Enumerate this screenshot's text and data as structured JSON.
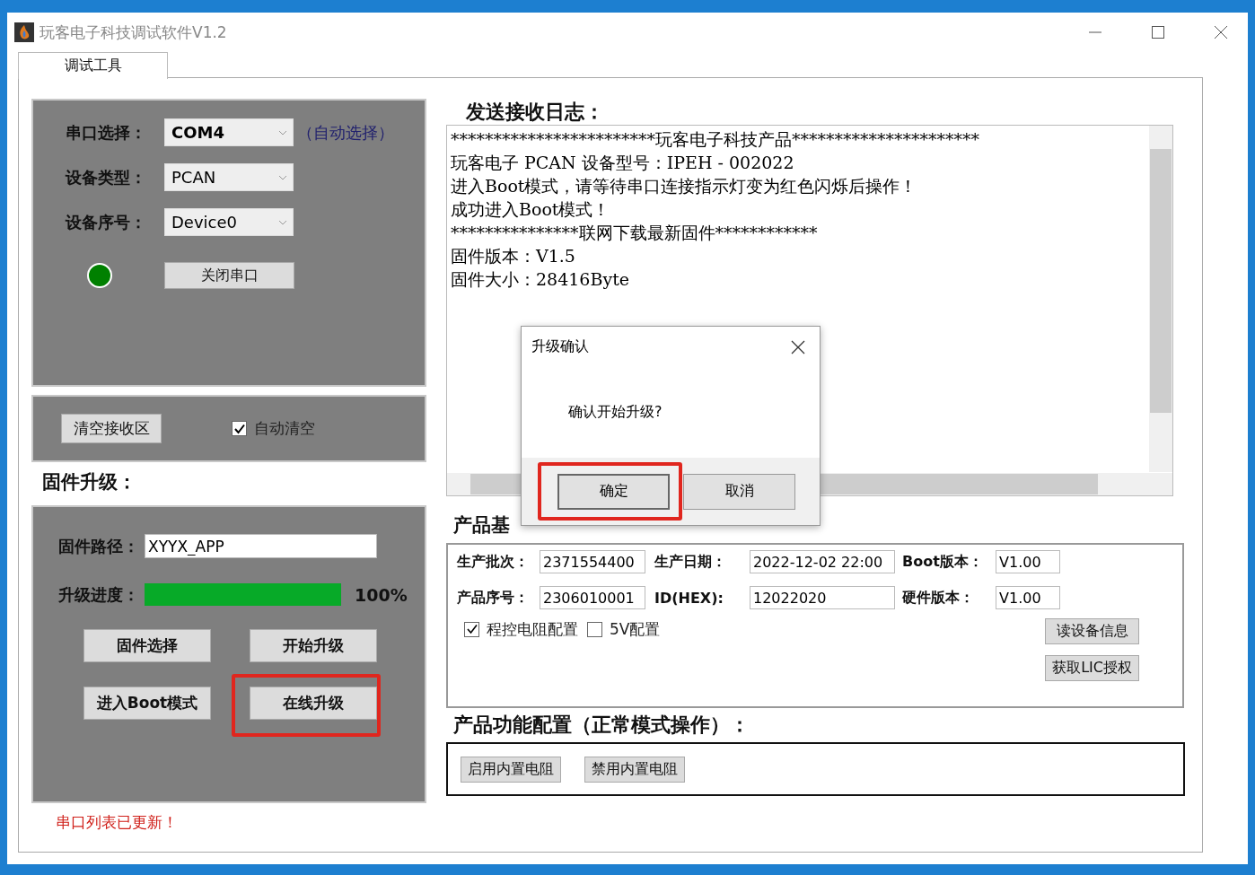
{
  "window": {
    "title": "玩客电子科技调试软件V1.2"
  },
  "tabs": [
    {
      "label": "调试工具",
      "selected": true
    }
  ],
  "serial": {
    "fields": [
      {
        "label": "串口选择：",
        "value": "COM4",
        "emphasis": true
      },
      {
        "label": "设备类型：",
        "value": "PCAN",
        "emphasis": false
      },
      {
        "label": "设备序号：",
        "value": "Device0",
        "emphasis": false
      }
    ],
    "hint": "（自动选择）",
    "connected": true,
    "button": "关闭串口"
  },
  "receive": {
    "clear_button": "清空接收区",
    "auto_clear": {
      "label": "自动清空",
      "checked": true
    }
  },
  "firmware": {
    "heading": "固件升级：",
    "path_label": "固件路径：",
    "path": "XYYX_APP",
    "progress_label": "升级进度：",
    "level": 1,
    "reading": "100%",
    "buttons": [
      {
        "label": "固件选择",
        "highlighted": false
      },
      {
        "label": "开始升级",
        "highlighted": false
      },
      {
        "label": "进入Boot模式",
        "highlighted": false
      },
      {
        "label": "在线升级",
        "highlighted": true
      }
    ]
  },
  "status_message": "串口列表已更新！",
  "log": {
    "heading": "发送接收日志：",
    "lines": [
      "************************玩客电子科技产品**********************",
      "玩客电子 PCAN 设备型号：IPEH - 002022",
      "进入Boot模式，请等待串口连接指示灯变为红色闪烁后操作！",
      "成功进入Boot模式！",
      "***************联网下载最新固件************",
      "固件版本：V1.5",
      "固件大小：28416Byte"
    ]
  },
  "product_info": {
    "heading": "产品基",
    "fields": [
      {
        "label": "生产批次：",
        "value": "2371554400"
      },
      {
        "label": "生产日期：",
        "value": "2022-12-02 22:00"
      },
      {
        "label": "Boot版本：",
        "value": "V1.00"
      },
      {
        "label": "产品序号：",
        "value": "2306010001"
      },
      {
        "label": "ID(HEX):",
        "value": "12022020"
      },
      {
        "label": "硬件版本：",
        "value": "V1.00"
      }
    ],
    "checkboxes": [
      {
        "label": "程控电阻配置",
        "checked": true
      },
      {
        "label": "5V配置",
        "checked": false
      }
    ],
    "buttons": [
      "读设备信息",
      "获取LIC授权"
    ]
  },
  "function_config": {
    "heading": "产品功能配置（正常模式操作）：",
    "buttons": [
      "启用内置电阻",
      "禁用内置电阻"
    ]
  },
  "dialog": {
    "title": "升级确认",
    "message": "确认开始升级?",
    "buttons": [
      {
        "label": "确定",
        "highlighted": true
      },
      {
        "label": "取消",
        "highlighted": false
      }
    ]
  }
}
